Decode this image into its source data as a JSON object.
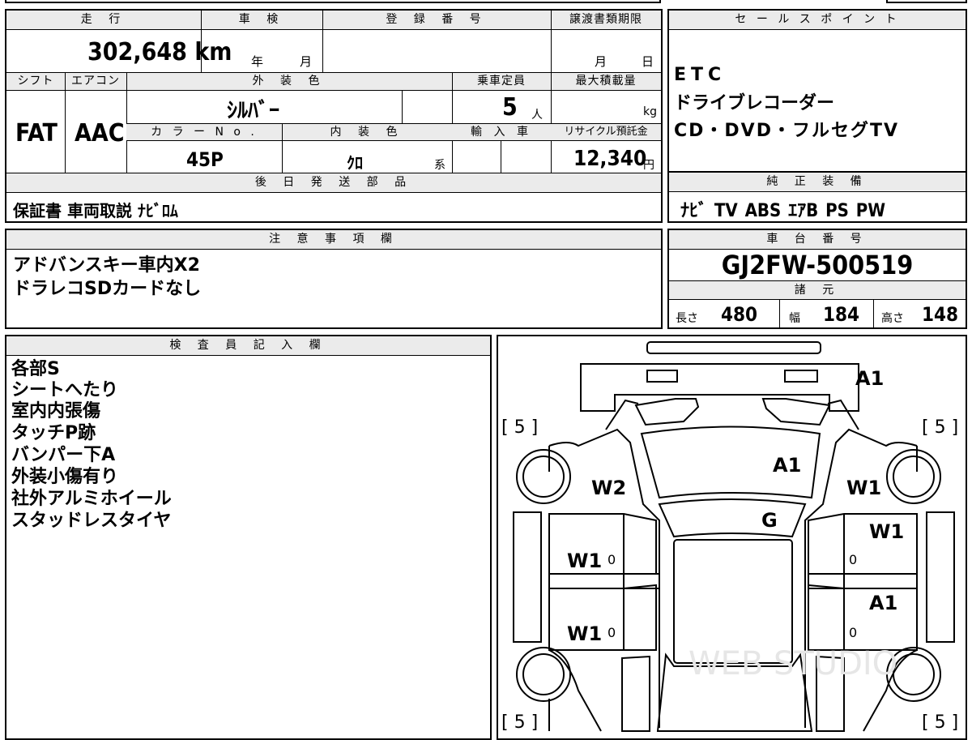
{
  "labels": {
    "mileage": "走 行",
    "inspection": "車 検",
    "registration": "登 録 番 号",
    "transfer_deadline": "譲渡書類期限",
    "sales_point": "セ ー ル ス ポ イ ン ト",
    "shift": "シフト",
    "aircon": "エアコン",
    "exterior_color": "外 装 色",
    "capacity": "乗車定員",
    "max_load": "最大積載量",
    "color_no": "カ ラ ー N o .",
    "interior_color": "内 装 色",
    "import": "輸 入 車",
    "recycle": "リサイクル預託金",
    "later_parts": "後 日 発 送 部 品",
    "genuine": "純 正 装 備",
    "notes": "注 意 事 項 欄",
    "chassis": "車 台 番 号",
    "specs": "諸 元",
    "inspector": "検 査 員 記 入 欄"
  },
  "units": {
    "year": "年",
    "month": "月",
    "month2": "月",
    "day": "日",
    "person": "人",
    "kg": "kg",
    "yen": "円",
    "kei": "系",
    "length": "長さ",
    "width": "幅",
    "height": "高さ"
  },
  "values": {
    "mileage": "302,648 km",
    "shift": "FAT",
    "aircon": "AAC",
    "exterior_color": "ｼﾙﾊﾞｰ",
    "capacity": "5",
    "color_no": "45P",
    "interior_color": "ｸﾛ",
    "recycle": "12,340",
    "later_parts": "保証書 車両取説 ﾅﾋﾞﾛﾑ",
    "genuine": "ﾅﾋﾞ  TV  ABS  ｴｱB  PS  PW",
    "chassis": "GJ2FW-500519",
    "length": "480",
    "width": "184",
    "height": "148"
  },
  "sales_points": [
    "ETC",
    "ドライブレコーダー",
    "CD・DVD・フルセグTV"
  ],
  "notes_lines": [
    "アドバンスキー車内X2",
    "ドラレコSDカードなし"
  ],
  "inspector_lines": [
    "各部S",
    "シートへたり",
    "室内内張傷",
    "タッチP跡",
    "バンパー下A",
    "外装小傷有り",
    "社外アルミホイール",
    "スタッドレスタイヤ"
  ],
  "diagram": {
    "tire_fl": "[ 5 ]",
    "tire_fr": "[ 5 ]",
    "tire_rl": "[ 5 ]",
    "tire_rr": "[ 5 ]",
    "front_bumper": "A1",
    "hood": "A1",
    "left_front_fender": "W2",
    "right_front_fender": "W1",
    "windshield": "G",
    "right_front_door": "W1",
    "left_front_door": "W1",
    "left_rear_door": "W1",
    "right_rear_door": "A1",
    "small_0a": "0",
    "small_0b": "0",
    "small_0c": "0",
    "small_0d": "0",
    "watermark": "WEB STUDIO"
  }
}
